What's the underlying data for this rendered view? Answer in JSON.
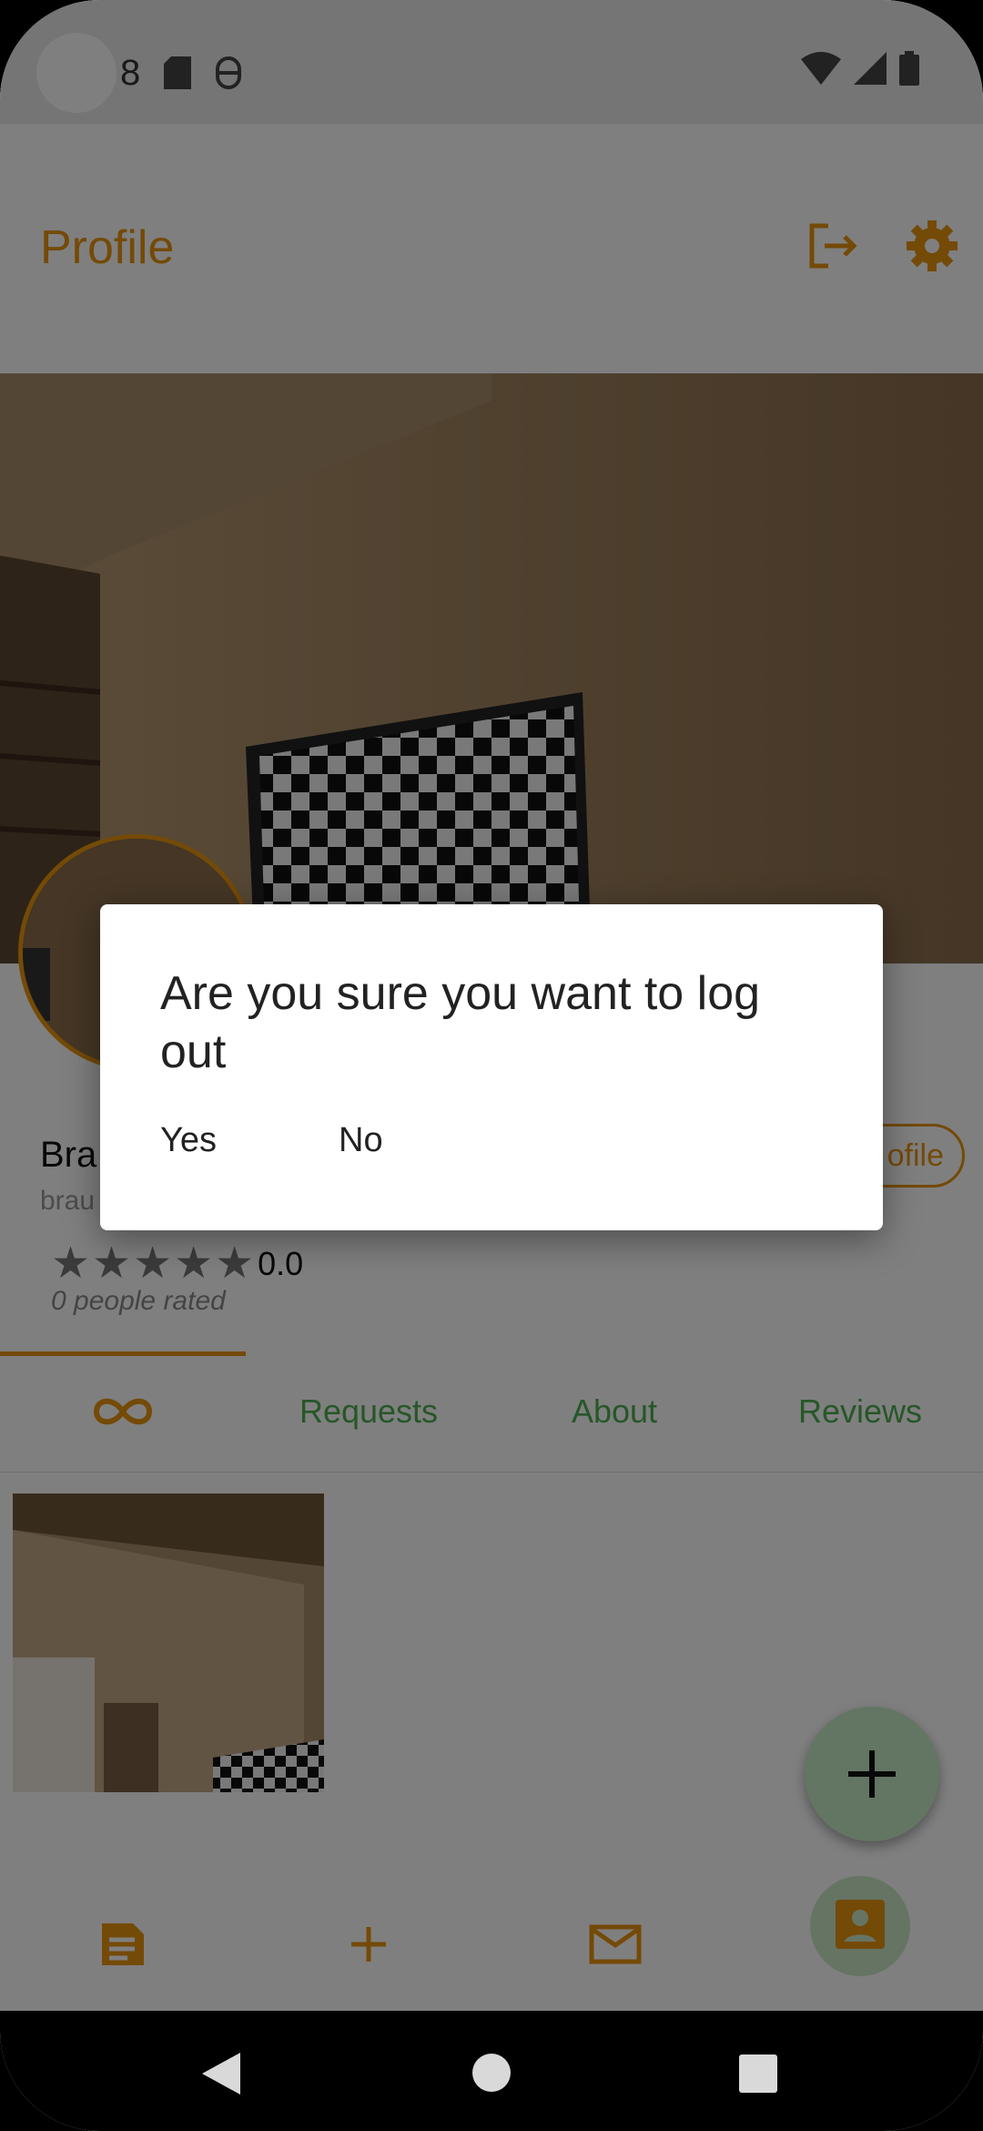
{
  "status_bar": {
    "notification_count": "8",
    "icons": [
      "sd-card-icon",
      "vpn-icon",
      "wifi-icon",
      "signal-icon",
      "battery-icon"
    ]
  },
  "app_bar": {
    "title": "Profile",
    "logout_icon": "logout-icon",
    "settings_icon": "gear-icon"
  },
  "profile": {
    "name": "Bra",
    "username": "brau",
    "edit_profile_label": "ofile",
    "rating": "0.0",
    "stars_filled": 0,
    "stars_total": 5,
    "people_rated": "0 people rated"
  },
  "tabs": [
    {
      "label": "",
      "icon": "infinity-icon",
      "selected": true
    },
    {
      "label": "Requests",
      "selected": false
    },
    {
      "label": "About",
      "selected": false
    },
    {
      "label": "Reviews",
      "selected": false
    }
  ],
  "fab": {
    "icon": "plus-icon"
  },
  "bottom_nav": [
    {
      "icon": "document-icon"
    },
    {
      "icon": "plus-icon"
    },
    {
      "icon": "mail-icon"
    },
    {
      "icon": "profile-icon",
      "selected": true
    }
  ],
  "dialog": {
    "message": "Are you sure you want to log out",
    "yes_label": "Yes",
    "no_label": "No"
  },
  "colors": {
    "accent": "#e8950f",
    "tab_text": "#4caf50",
    "fab_bg": "#c7eac6"
  }
}
